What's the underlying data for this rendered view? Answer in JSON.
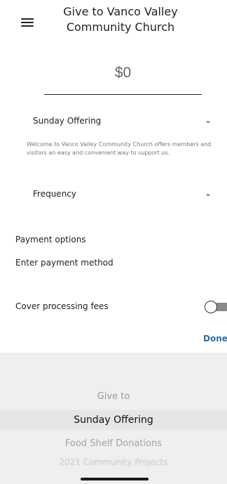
{
  "header": {
    "title_line1": "Give to Vanco Valley",
    "title_line2": "Community Church",
    "menu_icon": "hamburger-menu-icon"
  },
  "amount": {
    "value": "$0"
  },
  "fund": {
    "selected": "Sunday Offering",
    "chevron": "chevron-down-icon",
    "description": "Welcome to Vanco Valley Community Church offers members and visitors an easy and convenient way to support us."
  },
  "frequency": {
    "label": "Frequency",
    "chevron": "chevron-down-icon"
  },
  "payment": {
    "heading": "Payment options",
    "method_prompt": "Enter payment method"
  },
  "fees": {
    "label": "Cover processing fees",
    "enabled": false
  },
  "toolbar": {
    "done_label": "Done",
    "accent": "#2a6fa8"
  },
  "picker": {
    "heading": "Give to",
    "selected": "Sunday Offering",
    "options": [
      "Food Shelf Donations",
      "2021 Community Projects"
    ]
  }
}
